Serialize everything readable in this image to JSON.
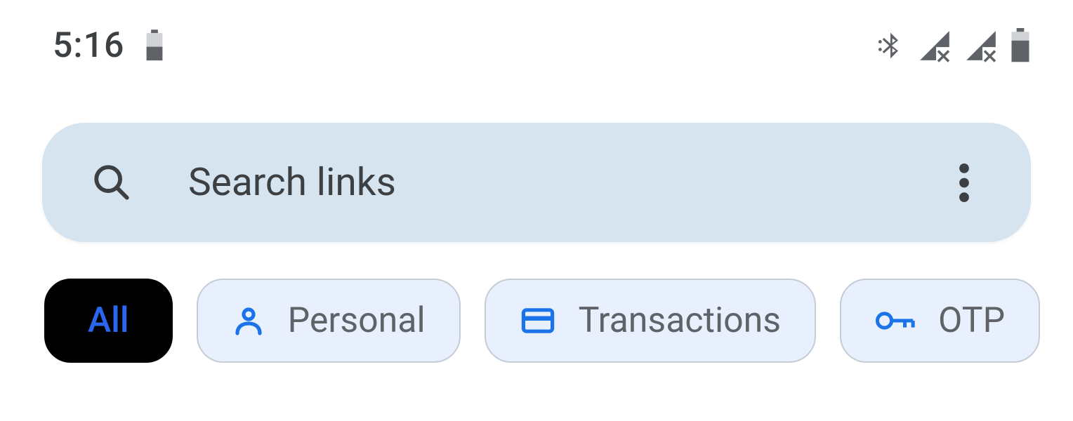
{
  "status_bar": {
    "time": "5:16",
    "icons": {
      "battery_left": "battery-half-icon",
      "bluetooth": "bluetooth-icon",
      "signal1": "signal-no-data-icon",
      "signal2": "signal-no-data-icon",
      "battery_right": "battery-icon"
    }
  },
  "search": {
    "placeholder": "Search links"
  },
  "chips": [
    {
      "label": "All",
      "selected": true,
      "icon": null
    },
    {
      "label": "Personal",
      "selected": false,
      "icon": "person-icon"
    },
    {
      "label": "Transactions",
      "selected": false,
      "icon": "credit-card-icon"
    },
    {
      "label": "OTP",
      "selected": false,
      "icon": "key-icon"
    }
  ],
  "colors": {
    "accent": "#1a73e8",
    "chip_bg": "#e8f0fe",
    "search_bg": "#d6e4ef",
    "text": "#3c4043"
  }
}
